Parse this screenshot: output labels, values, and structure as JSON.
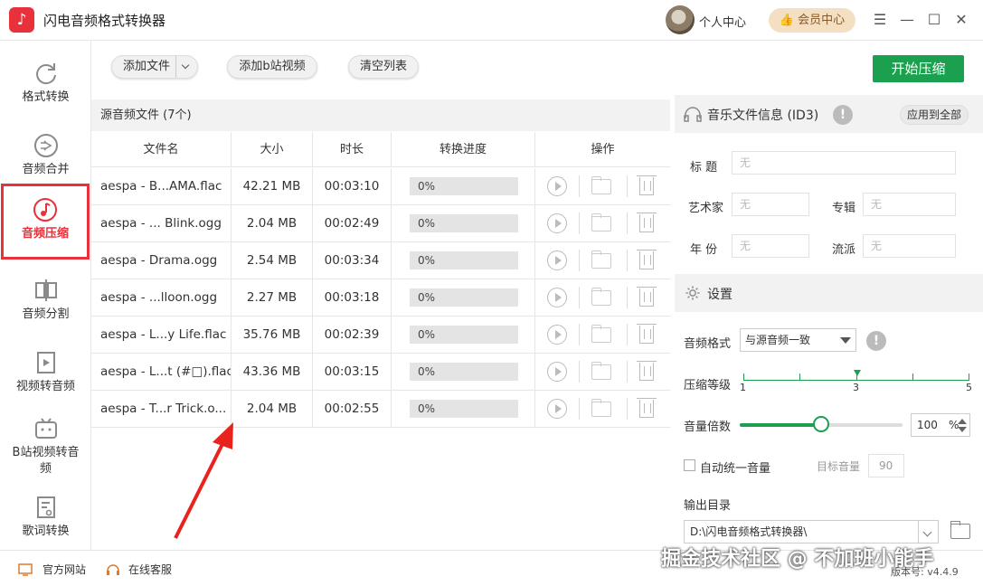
{
  "app": {
    "title": "闪电音频格式转换器",
    "logo_glyph": "♪"
  },
  "header": {
    "user_center": "个人中心",
    "vip_center": "会员中心",
    "window_controls": [
      "menu-icon",
      "minimize-icon",
      "maximize-icon",
      "close-icon"
    ]
  },
  "sidebar": {
    "items": [
      {
        "label": "格式转换",
        "icon": "refresh-icon"
      },
      {
        "label": "音频合并",
        "icon": "merge-icon"
      },
      {
        "label": "音频压缩",
        "icon": "music-note-icon",
        "active": true
      },
      {
        "label": "音频分割",
        "icon": "split-icon"
      },
      {
        "label": "视频转音频",
        "icon": "video-icon"
      },
      {
        "label": "B站视频转音频",
        "icon": "tv-icon"
      },
      {
        "label": "歌词转换",
        "icon": "lyrics-icon"
      }
    ]
  },
  "toolbar": {
    "add_file": "添加文件",
    "add_bilibili": "添加b站视频",
    "clear_list": "清空列表",
    "start": "开始压缩"
  },
  "file_list": {
    "header": "源音频文件 (7个)",
    "columns": [
      "文件名",
      "大小",
      "时长",
      "转换进度",
      "操作"
    ],
    "rows": [
      {
        "name": "aespa - B...AMA.flac",
        "size": "42.21 MB",
        "duration": "00:03:10",
        "progress": "0%"
      },
      {
        "name": "aespa - ... Blink.ogg",
        "size": "2.04 MB",
        "duration": "00:02:49",
        "progress": "0%"
      },
      {
        "name": "aespa - Drama.ogg",
        "size": "2.54 MB",
        "duration": "00:03:34",
        "progress": "0%"
      },
      {
        "name": "aespa - ...lloon.ogg",
        "size": "2.27 MB",
        "duration": "00:03:18",
        "progress": "0%"
      },
      {
        "name": "aespa - L...y Life.flac",
        "size": "35.76 MB",
        "duration": "00:02:39",
        "progress": "0%"
      },
      {
        "name": "aespa - L...t (#□).flac",
        "size": "43.36 MB",
        "duration": "00:03:15",
        "progress": "0%"
      },
      {
        "name": "aespa - T...r Trick.o...",
        "size": "2.04 MB",
        "duration": "00:02:55",
        "progress": "0%"
      }
    ]
  },
  "id3": {
    "title": "音乐文件信息 (ID3)",
    "apply_all": "应用到全部",
    "fields": {
      "title_label": "标  题",
      "artist_label": "艺术家",
      "album_label": "专辑",
      "year_label": "年  份",
      "genre_label": "流派",
      "placeholder": "无"
    }
  },
  "settings": {
    "title": "设置",
    "format_label": "音频格式",
    "format_value": "与源音频一致",
    "level_label": "压缩等级",
    "level_ticks": [
      "1",
      "3",
      "5"
    ],
    "level_value": 3,
    "volume_label": "音量倍数",
    "volume_value": "100",
    "volume_unit": "%",
    "volume_fraction": 0.5,
    "auto_volume_label": "自动统一音量",
    "target_volume_label": "目标音量",
    "target_volume_value": "90",
    "output_label": "输出目录",
    "output_path": "D:\\闪电音频格式转换器\\"
  },
  "footer": {
    "official_site": "官方网站",
    "online_service": "在线客服",
    "watermark": "掘金技术社区 @ 不加班小能手",
    "version": "版本号: v4.4.9"
  },
  "colors": {
    "accent_red": "#e8313b",
    "accent_green": "#1aa04e",
    "vip_bg": "#f5dfc3"
  }
}
